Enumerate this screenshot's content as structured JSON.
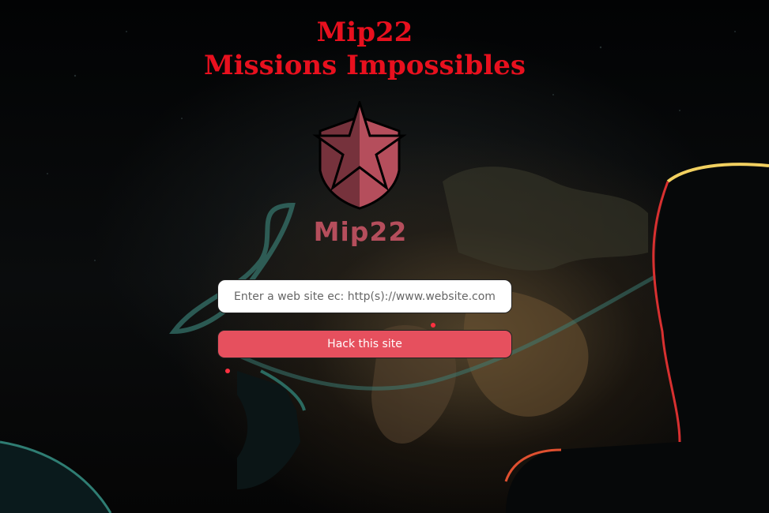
{
  "header": {
    "line1": "Mip22",
    "line2": "Missions Impossibles"
  },
  "logo": {
    "icon": "star-shield-icon",
    "text": "Mip22"
  },
  "form": {
    "url_placeholder": "Enter a web site ec: http(s)://www.website.com",
    "url_value": "",
    "submit_label": "Hack this site"
  },
  "colors": {
    "title": "#e8101e",
    "logo": "#b54e5c",
    "button": "#e6505e"
  }
}
